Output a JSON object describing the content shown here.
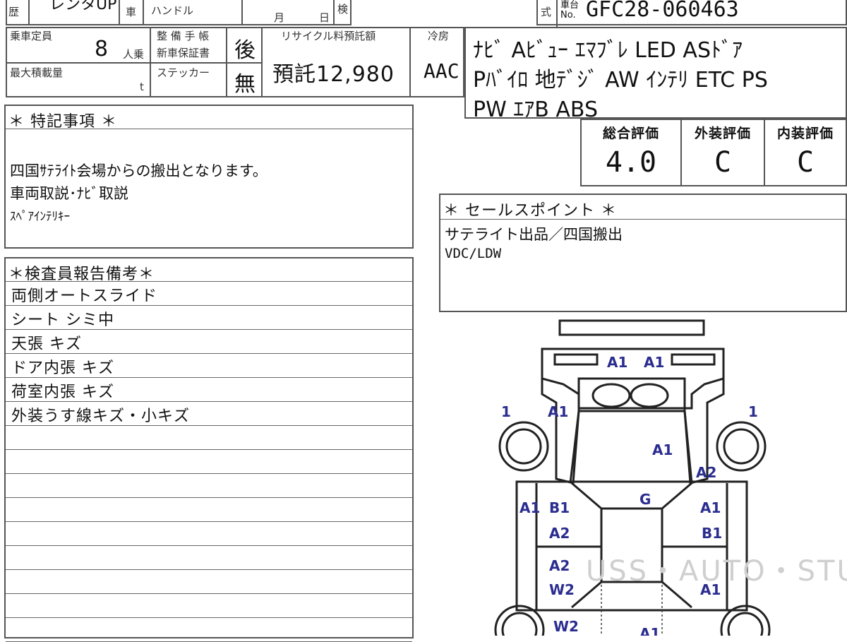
{
  "header": {
    "reki_label": "歴",
    "model_partial": "レンタUP",
    "sha_label": "車",
    "handle_label": "ハンドル",
    "tsuki_label": "月",
    "hi_label": "日",
    "ken_label": "検",
    "shiki_label": "式",
    "chassis_label_top": "車台",
    "chassis_label_bottom": "No.",
    "chassis_number": "GFC28-060463"
  },
  "capacity": {
    "label": "乗車定員",
    "value": "8",
    "unit": "人乗"
  },
  "max_load": {
    "label": "最大積載量",
    "unit": "t"
  },
  "warranty": {
    "label_1": "整 備 手 帳",
    "label_2": "新車保証書",
    "value": "後"
  },
  "sticker": {
    "label": "ステッカー",
    "value": "無"
  },
  "recycle": {
    "label": "リサイクル料預託額",
    "value": "預託12,980"
  },
  "aircon": {
    "label": "冷房",
    "value": "AAC"
  },
  "equipment": {
    "line1": "ﾅﾋﾞ Aﾋﾞｭｰ ｴﾏﾌﾞﾚ LED ASﾄﾞｱ",
    "line2": "Pﾊﾞｲﾛ 地ﾃﾞｼﾞ AW ｲﾝﾃﾘ ETC PS",
    "line3": "PW ｴｱB ABS"
  },
  "grades": {
    "overall_label": "総合評価",
    "overall_value": "4.0",
    "exterior_label": "外装評価",
    "exterior_value": "C",
    "interior_label": "内装評価",
    "interior_value": "C"
  },
  "special_notes": {
    "title": "＊ 特記事項 ＊",
    "lines": [
      "四国ｻﾃﾗｲﾄ会場からの搬出となります。",
      "車両取説･ﾅﾋﾞ取説",
      "ｽﾍﾟｱｲﾝﾃﾘｷｰ"
    ]
  },
  "sales_points": {
    "title": "＊ セールスポイント ＊",
    "lines": [
      "サテライト出品／四国搬出",
      "VDC/LDW"
    ]
  },
  "inspector_report": {
    "title": "＊検査員報告備考＊",
    "rows": [
      "両側オートスライド",
      "シート シミ中",
      "天張 キズ",
      "ドア内張 キズ",
      "荷室内張 キズ",
      "外装うす線キズ・小キズ",
      "",
      "",
      "",
      "",
      "",
      "",
      "",
      "",
      "",
      ""
    ]
  },
  "diagram": {
    "marks": {
      "top_left": "A1",
      "top_right": "A1",
      "front_left_wheel": "1",
      "front_right_wheel": "1",
      "front_left_fender": "A1",
      "hood": "A1",
      "front_right_fender": "A2",
      "left_front_door_1": "A1",
      "left_front_door_2": "B1",
      "left_front_door_3": "A2",
      "roof": "G",
      "right_front_door_1": "A1",
      "right_front_door_2": "B1",
      "left_rear_door_1": "A2",
      "left_rear_door_2": "W2",
      "right_rear_door": "A1",
      "left_rear_quarter": "W2",
      "rear_center": "A1"
    },
    "watermark": "USS・AUTO・STUDIO・PRO"
  },
  "colors": {
    "border": "#555555",
    "damage_mark": "#2b2d8f",
    "text": "#111111"
  }
}
